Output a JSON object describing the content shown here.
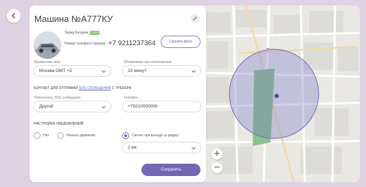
{
  "header": {
    "title": "Машина №А777КУ"
  },
  "car": {
    "battery_label": "Заряд батареи",
    "battery_value": "100%",
    "phone_label": "Номер телефона трекера",
    "phone_number": "+7 9211237364",
    "change_photo_label": "Сменить фото"
  },
  "settings": {
    "timezone_label": "Временная зона",
    "timezone_value": "Москва GMT +3",
    "update_label": "Обновление местоположения",
    "update_value": "10 минут"
  },
  "sos": {
    "title_prefix": "КОНТАКТ ДЛЯ ОТПРАВКИ ",
    "title_link": "SOS СООБЩЕНИЯ",
    "title_suffix": " С ТРЕКЕРА",
    "recipient_label": "Получатель SOS сообщения",
    "recipient_value": "Другой",
    "phone_label": "Телефон",
    "phone_value": "+79210000000"
  },
  "notifications": {
    "title": "НАСТРОЙКА УВЕДОМЛЕНИЙ",
    "options": [
      {
        "label": "Нет",
        "selected": false
      },
      {
        "label": "Начало движения",
        "selected": false
      },
      {
        "label": "Сигнал при выходе за радиус",
        "selected": true
      }
    ],
    "radius_value": "2 км"
  },
  "actions": {
    "save_label": "Сохранить"
  },
  "map": {
    "zoom_in_label": "+",
    "zoom_out_label": "−",
    "geofence_color": "#7a78c8",
    "park_color": "#8cc08a"
  },
  "colors": {
    "accent": "#7367b4",
    "background": "#ddd3e2"
  }
}
